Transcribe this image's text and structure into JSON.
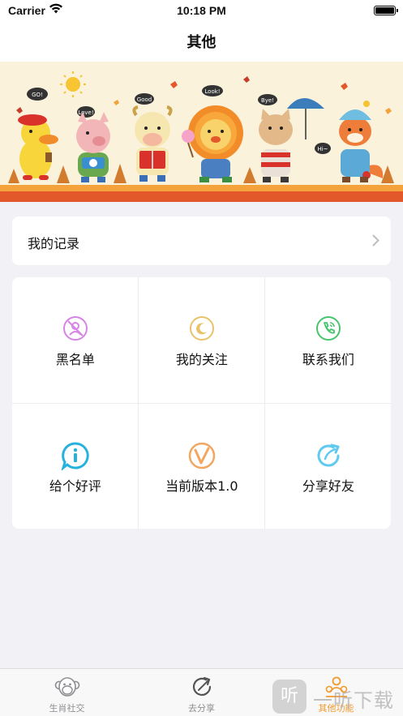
{
  "status_bar": {
    "carrier": "Carrier",
    "time": "10:18 PM"
  },
  "nav": {
    "title": "其他"
  },
  "banner": {
    "speech": [
      "GO!",
      "Love!",
      "Good",
      "Look!",
      "Bye!",
      "Hi~"
    ]
  },
  "records": {
    "label": "我的记录"
  },
  "grid": [
    {
      "label": "黑名单",
      "icon": "blocked-user-icon",
      "color": "#d884e6"
    },
    {
      "label": "我的关注",
      "icon": "moon-follow-icon",
      "color": "#e9c36a"
    },
    {
      "label": "联系我们",
      "icon": "phone-icon",
      "color": "#47c46e"
    },
    {
      "label": "给个好评",
      "icon": "info-bubble-icon",
      "color": "#27b1dd"
    },
    {
      "label": "当前版本1.0",
      "icon": "version-v-icon",
      "color": "#f2a65f"
    },
    {
      "label": "分享好友",
      "icon": "share-arrow-icon",
      "color": "#5fc9ef"
    }
  ],
  "tabs": [
    {
      "label": "生肖社交",
      "icon": "monkey-icon",
      "active": false
    },
    {
      "label": "去分享",
      "icon": "share-icon",
      "active": false
    },
    {
      "label": "其他功能",
      "icon": "people-icon",
      "active": true
    }
  ],
  "watermark": {
    "box": "听",
    "text": "一听下载"
  },
  "colors": {
    "accent": "#f29a2e",
    "background": "#f2f2f6"
  }
}
